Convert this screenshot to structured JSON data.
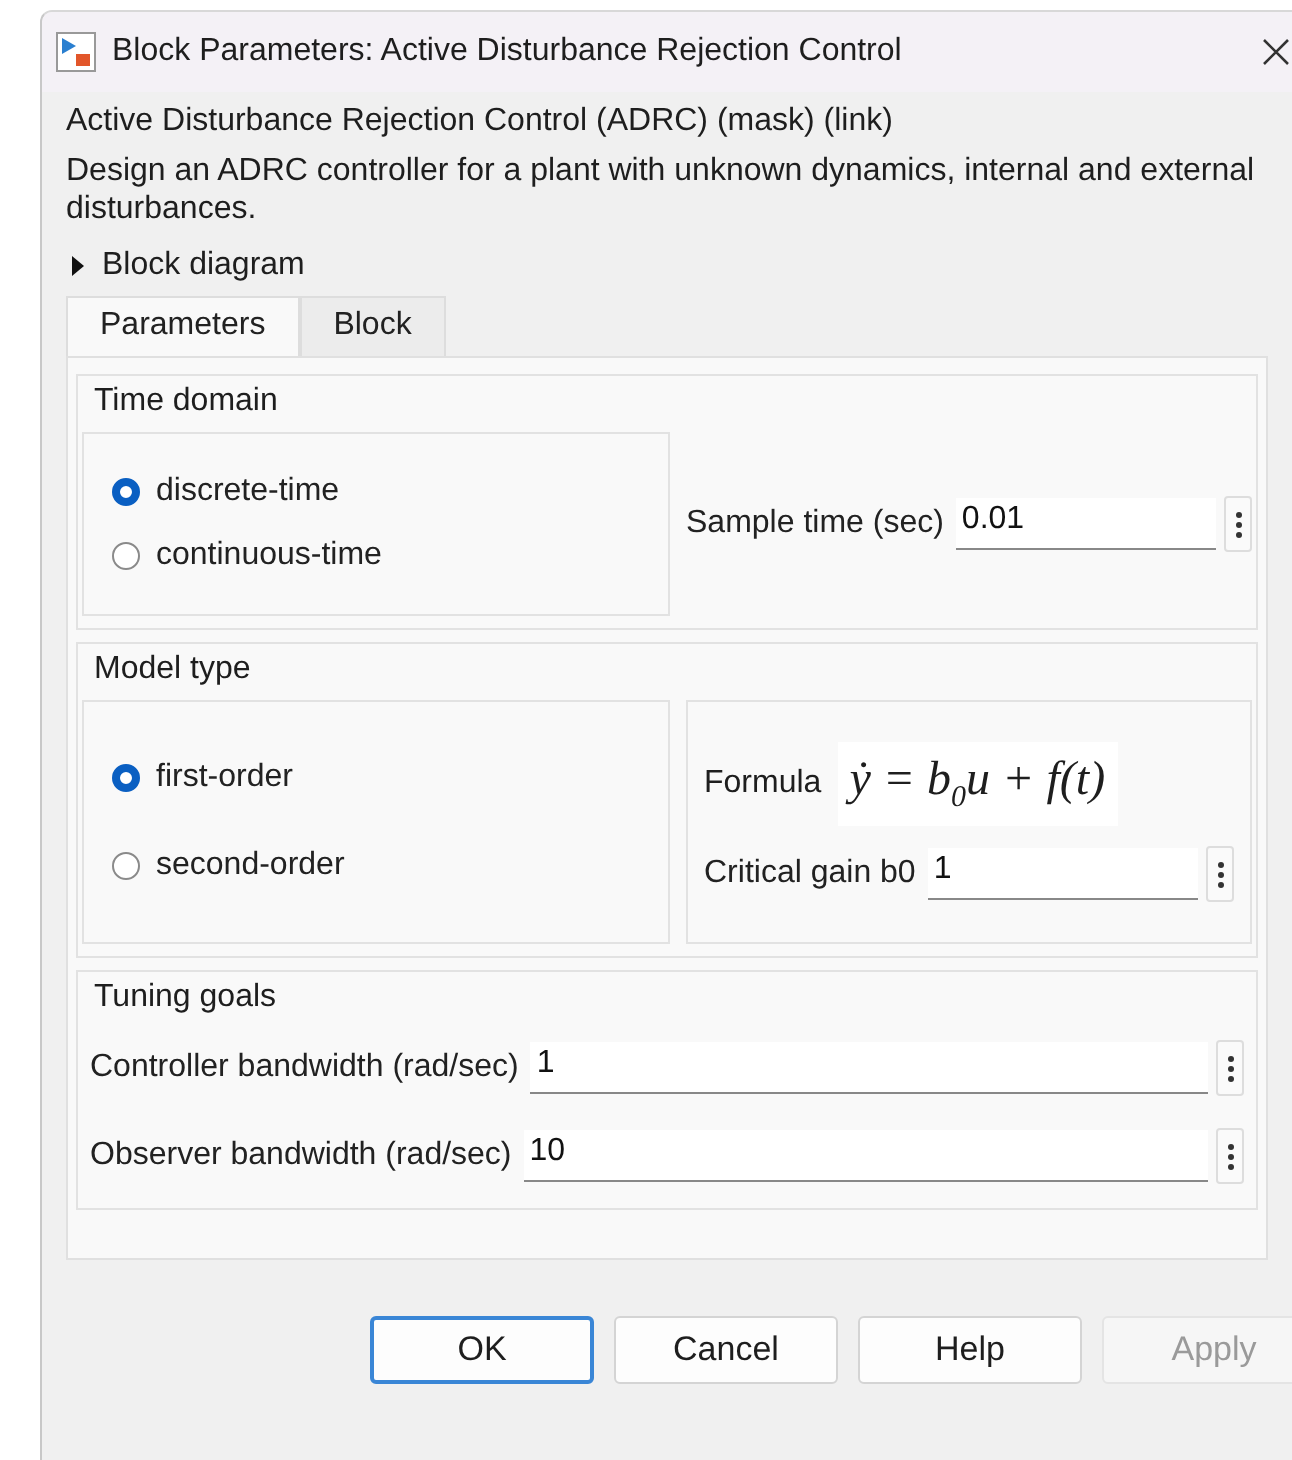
{
  "window": {
    "title": "Block Parameters: Active Disturbance Rejection Control"
  },
  "block_header": "Active Disturbance Rejection Control (ADRC) (mask) (link)",
  "description": "Design an ADRC controller for a plant with unknown dynamics, internal and external disturbances.",
  "block_diagram": {
    "label": "Block diagram",
    "expanded": false
  },
  "tabs": [
    {
      "label": "Parameters",
      "selected": true
    },
    {
      "label": "Block",
      "selected": false
    }
  ],
  "time_domain": {
    "title": "Time domain",
    "options": [
      {
        "label": "discrete-time",
        "selected": true
      },
      {
        "label": "continuous-time",
        "selected": false
      }
    ],
    "sample_time": {
      "label": "Sample time (sec)",
      "value": "0.01"
    }
  },
  "model_type": {
    "title": "Model type",
    "options": [
      {
        "label": "first-order",
        "selected": true
      },
      {
        "label": "second-order",
        "selected": false
      }
    ],
    "formula": {
      "label": "Formula",
      "expression": "ẏ = b$_{0}$u + f(t)"
    },
    "critical_gain": {
      "label": "Critical gain b0",
      "value": "1"
    }
  },
  "tuning_goals": {
    "title": "Tuning goals",
    "fields": [
      {
        "label": "Controller bandwidth (rad/sec)",
        "value": "1"
      },
      {
        "label": "Observer bandwidth (rad/sec)",
        "value": "10"
      }
    ]
  },
  "buttons": [
    {
      "label": "OK",
      "focused": true,
      "disabled": false
    },
    {
      "label": "Cancel",
      "focused": false,
      "disabled": false
    },
    {
      "label": "Help",
      "focused": false,
      "disabled": false
    },
    {
      "label": "Apply",
      "focused": false,
      "disabled": true
    }
  ]
}
